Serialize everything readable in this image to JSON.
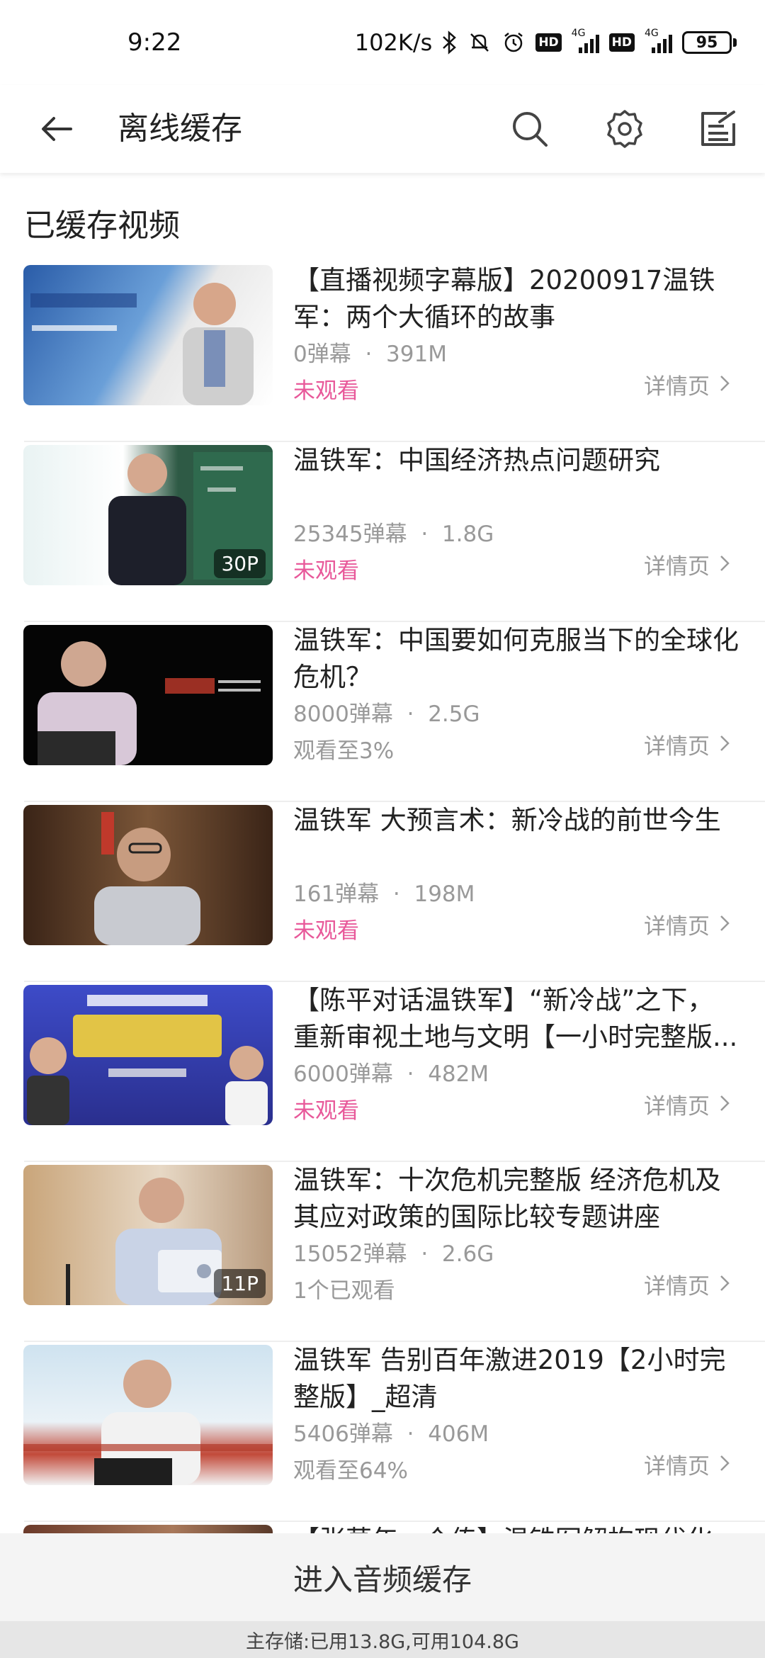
{
  "status_bar": {
    "time": "9:22",
    "net_speed": "102K/s",
    "battery": "95",
    "hd1": "HD",
    "hd2": "HD",
    "net1": "4G",
    "net2": "4G"
  },
  "app_bar": {
    "title": "离线缓存",
    "icons": [
      "back-arrow-icon",
      "search-icon",
      "gear-icon",
      "edit-list-icon"
    ]
  },
  "section_title": "已缓存视频",
  "videos": [
    {
      "title": "【直播视频字幕版】20200917温铁军：两个大循环的故事",
      "danmaku": "0弹幕",
      "size": "391M",
      "status": "未观看",
      "status_type": "unwatched",
      "badge": "",
      "detail": "详情页"
    },
    {
      "title": "温铁军：中国经济热点问题研究",
      "danmaku": "25345弹幕",
      "size": "1.8G",
      "status": "未观看",
      "status_type": "unwatched",
      "badge": "30P",
      "detail": "详情页"
    },
    {
      "title": "温铁军：中国要如何克服当下的全球化危机？",
      "danmaku": "8000弹幕",
      "size": "2.5G",
      "status": "观看至3%",
      "status_type": "watched",
      "badge": "",
      "detail": "详情页"
    },
    {
      "title": "温铁军 大预言术：新冷战的前世今生",
      "danmaku": "161弹幕",
      "size": "198M",
      "status": "未观看",
      "status_type": "unwatched",
      "badge": "",
      "detail": "详情页"
    },
    {
      "title": "【陈平对话温铁军】“新冷战”之下，重新审视土地与文明【一小时完整版...",
      "danmaku": "6000弹幕",
      "size": "482M",
      "status": "未观看",
      "status_type": "unwatched",
      "badge": "",
      "detail": "详情页"
    },
    {
      "title": "温铁军：十次危机完整版 经济危机及其应对政策的国际比较专题讲座",
      "danmaku": "15052弹幕",
      "size": "2.6G",
      "status": "1个已观看",
      "status_type": "watched",
      "badge": "11P",
      "detail": "详情页"
    },
    {
      "title": "温铁军 告别百年激进2019【2小时完整版】_超清",
      "danmaku": "5406弹幕",
      "size": "406M",
      "status": "观看至64%",
      "status_type": "watched",
      "badge": "",
      "detail": "详情页"
    },
    {
      "title": "【张莫年一个传】温铁军解构现代化",
      "danmaku": "",
      "size": "",
      "status": "",
      "status_type": "watched",
      "badge": "",
      "detail": ""
    }
  ],
  "meta_separator": "·",
  "audio_button": "进入音频缓存",
  "storage_info": "主存储:已用13.8G,可用104.8G",
  "colors": {
    "accent_pink": "#e8599a",
    "muted_text": "#999999",
    "bottom_bar": "#f4f4f4"
  }
}
